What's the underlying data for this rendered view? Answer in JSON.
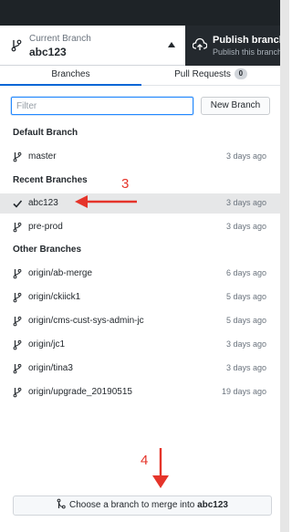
{
  "toolbar": {
    "current_branch_label": "Current Branch",
    "current_branch_value": "abc123",
    "publish_title": "Publish branch",
    "publish_subtitle": "Publish this branch"
  },
  "tabs": {
    "branches": "Branches",
    "pull_requests": "Pull Requests",
    "pull_requests_count": "0"
  },
  "filter": {
    "placeholder": "Filter",
    "value": ""
  },
  "new_branch_label": "New Branch",
  "sections": {
    "default": "Default Branch",
    "recent": "Recent Branches",
    "other": "Other Branches"
  },
  "default_branches": [
    {
      "name": "master",
      "time": "3 days ago",
      "icon": "branch-icon"
    }
  ],
  "recent_branches": [
    {
      "name": "abc123",
      "time": "3 days ago",
      "icon": "check-icon",
      "selected": true
    },
    {
      "name": "pre-prod",
      "time": "3 days ago",
      "icon": "branch-icon"
    }
  ],
  "other_branches": [
    {
      "name": "origin/ab-merge",
      "time": "6 days ago",
      "icon": "branch-icon"
    },
    {
      "name": "origin/ckiick1",
      "time": "5 days ago",
      "icon": "branch-icon"
    },
    {
      "name": "origin/cms-cust-sys-admin-jc",
      "time": "5 days ago",
      "icon": "branch-icon"
    },
    {
      "name": "origin/jc1",
      "time": "3 days ago",
      "icon": "branch-icon"
    },
    {
      "name": "origin/tina3",
      "time": "3 days ago",
      "icon": "branch-icon"
    },
    {
      "name": "origin/upgrade_20190515",
      "time": "19 days ago",
      "icon": "branch-icon"
    }
  ],
  "annotations": {
    "step3": "3",
    "step4": "4",
    "color": "#e5342a"
  },
  "merge": {
    "prefix": "Choose a branch to merge into",
    "branch": "abc123"
  },
  "colors": {
    "accent": "#0366d6",
    "selected_row": "#e6e7e8",
    "publish_bg": "#24292e"
  }
}
